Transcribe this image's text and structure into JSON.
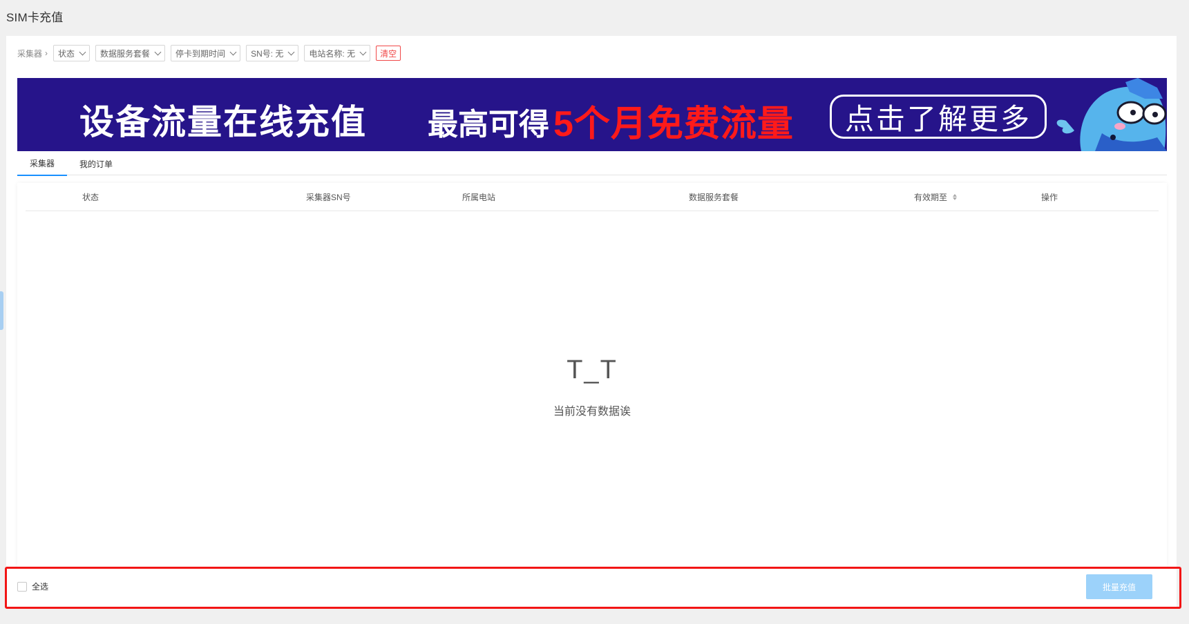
{
  "page": {
    "title": "SIM卡充值"
  },
  "filters": {
    "breadcrumb": "采集器",
    "status": "状态",
    "data_plan": "数据服务套餐",
    "expiry": "停卡到期时间",
    "sn": "SN号: 无",
    "station": "电站名称: 无",
    "clear": "清空"
  },
  "banner": {
    "headline": "设备流量在线充值",
    "offer_prefix": "最高可得",
    "offer_highlight": "5个月免费流量",
    "cta": "点击了解更多",
    "colors": {
      "background": "#26148a",
      "highlight": "#ff1a1a"
    }
  },
  "tabs": [
    {
      "label": "采集器",
      "active": true
    },
    {
      "label": "我的订单",
      "active": false
    }
  ],
  "table": {
    "columns": [
      "状态",
      "采集器SN号",
      "所属电站",
      "数据服务套餐",
      "有效期至",
      "操作"
    ],
    "rows": [],
    "empty_face": "T_T",
    "empty_text": "当前没有数据诶"
  },
  "footer": {
    "select_all": "全选",
    "batch_recharge": "批量充值"
  },
  "colors": {
    "accent": "#1890ff",
    "danger": "#f04848",
    "highlight_outline": "#f21515"
  }
}
